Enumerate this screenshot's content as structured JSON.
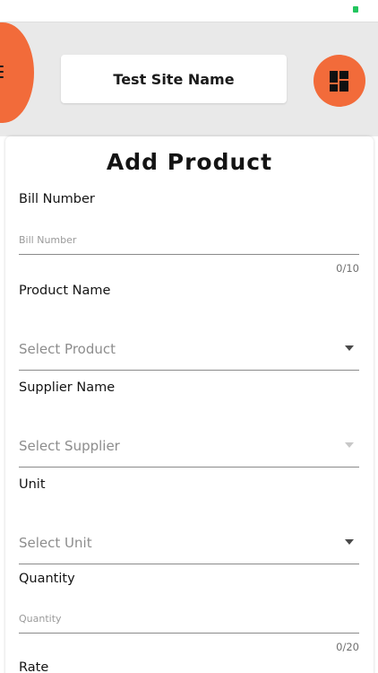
{
  "header": {
    "site_name": "Test Site Name",
    "menu_icon": "hamburger-menu-icon",
    "dashboard_icon": "dashboard-grid-icon",
    "accent_color": "#f26b3a"
  },
  "form": {
    "title": "Add Product",
    "bill_number": {
      "label": "Bill Number",
      "placeholder": "Bill Number",
      "value": "",
      "counter": "0/10"
    },
    "product_name": {
      "label": "Product Name",
      "selected": "Select Product"
    },
    "supplier_name": {
      "label": "Supplier Name",
      "selected": "Select Supplier"
    },
    "unit": {
      "label": "Unit",
      "selected": "Select Unit"
    },
    "quantity": {
      "label": "Quantity",
      "placeholder": "Quantity",
      "value": "",
      "counter": "0/20"
    },
    "rate": {
      "label": "Rate"
    }
  }
}
